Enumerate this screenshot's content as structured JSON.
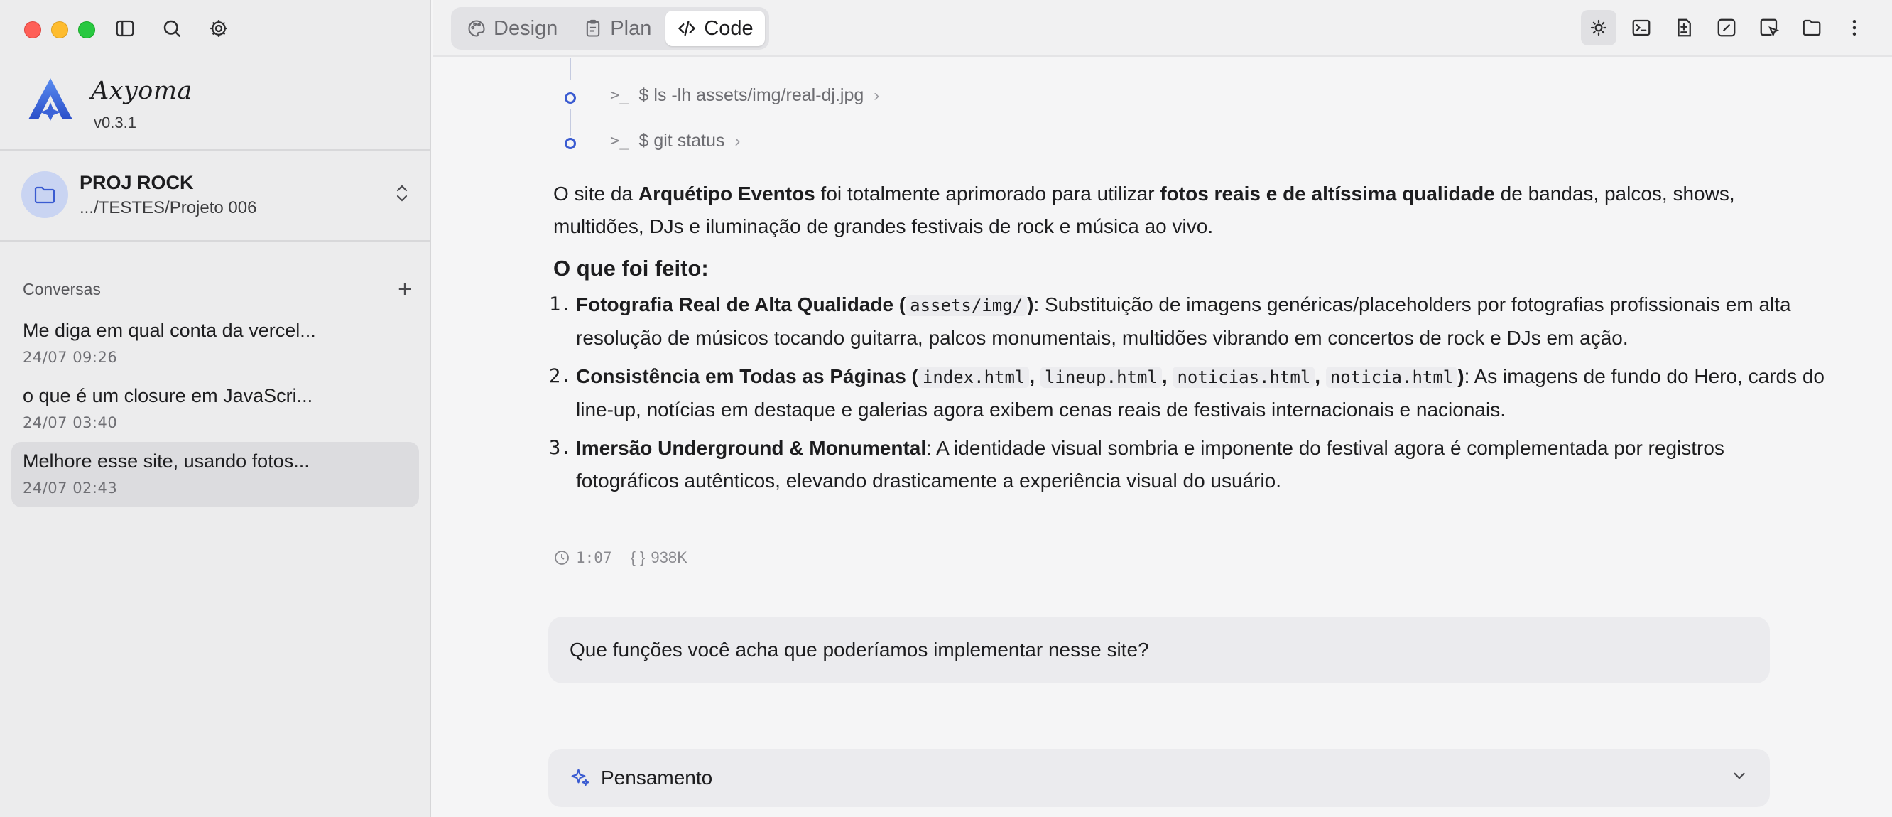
{
  "app": {
    "name": "Axyoma",
    "version": "v0.3.1"
  },
  "project": {
    "name": "PROJ ROCK",
    "path": ".../TESTES/Projeto 006"
  },
  "conversations": {
    "title": "Conversas",
    "add_label": "+",
    "items": [
      {
        "title": "Me diga em qual conta da vercel...",
        "date": "24/07 09:26"
      },
      {
        "title": "o que é um closure em JavaScri...",
        "date": "24/07 03:40"
      },
      {
        "title": "Melhore esse site, usando fotos...",
        "date": "24/07 02:43"
      }
    ],
    "active_index": 2
  },
  "tabs": [
    {
      "label": "Design",
      "icon": "palette-icon"
    },
    {
      "label": "Plan",
      "icon": "clipboard-icon"
    },
    {
      "label": "Code",
      "icon": "code-icon"
    }
  ],
  "active_tab": "Code",
  "toolbar_icons": [
    "sun-icon",
    "terminal-icon",
    "diff-file-icon",
    "edit-square-icon",
    "select-cursor-icon",
    "folder-icon",
    "more-vertical-icon"
  ],
  "commands": [
    {
      "prompt": ">_",
      "text": "$ ls -lh assets/img/real-dj.jpg"
    },
    {
      "prompt": ">_",
      "text": "$ git status"
    }
  ],
  "message": {
    "intro": {
      "p1": "O site da ",
      "b1": "Arquétipo Eventos",
      "p2": " foi totalmente aprimorado para utilizar ",
      "b2": "fotos reais e de altíssima qualidade",
      "p3": " de bandas, palcos, shows, multidões, DJs e iluminação de grandes festivais de rock e música ao vivo."
    },
    "heading": "O que foi feito:",
    "items": [
      {
        "num": "1.",
        "bold": "Fotografia Real de Alta Qualidade (",
        "codes": [
          "assets/img/"
        ],
        "bold_end": ")",
        "text": ": Substituição de imagens genéricas/placeholders por fotografias profissionais em alta resolução de músicos tocando guitarra, palcos monumentais, multidões vibrando em concertos de rock e DJs em ação."
      },
      {
        "num": "2.",
        "bold": "Consistência em Todas as Páginas (",
        "codes": [
          "index.html",
          "lineup.html",
          "noticias.html",
          "noticia.html"
        ],
        "bold_end": ")",
        "text": ": As imagens de fundo do Hero, cards do line-up, notícias em destaque e galerias agora exibem cenas reais de festivais internacionais e nacionais."
      },
      {
        "num": "3.",
        "bold": "Imersão Underground & Monumental",
        "text": ": A identidade visual sombria e imponente do festival agora é complementada por registros fotográficos autênticos, elevando drasticamente a experiência visual do usuário."
      }
    ],
    "meta": {
      "time": "1:07",
      "tokens": "938K",
      "tokens_prefix": "{ }"
    }
  },
  "user_message": "Que funções você acha que poderíamos implementar nesse site?",
  "thinking": {
    "label": "Pensamento"
  },
  "colors": {
    "accent": "#3a5bd1",
    "sidebar_bg": "#ececed",
    "main_bg": "#f5f5f6"
  }
}
